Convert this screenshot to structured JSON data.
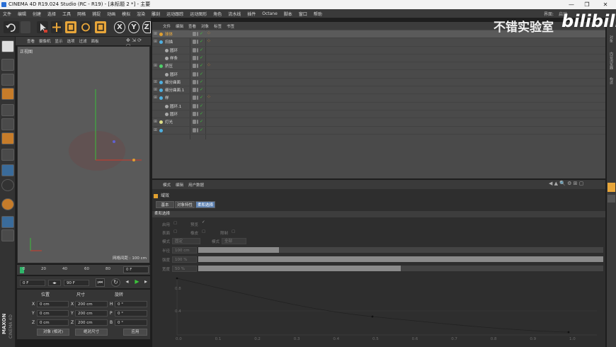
{
  "window": {
    "title": "CINEMA 4D R19.024 Studio (RC - R19) - [未标题 2 *] - 主要",
    "controls": [
      "—",
      "❐",
      "✕"
    ]
  },
  "menubar": {
    "items": [
      "文件",
      "编辑",
      "创建",
      "选择",
      "工具",
      "网格",
      "捕捉",
      "动画",
      "模拟",
      "渲染",
      "雕刻",
      "运动跟踪",
      "运动图形",
      "角色",
      "流水线",
      "插件",
      "Octane",
      "脚本",
      "窗口",
      "帮助"
    ],
    "layout_label": "界面:",
    "layout_value": "启动"
  },
  "toolbar": {
    "axis_x": "X",
    "axis_y": "Y",
    "axis_z": "Z"
  },
  "viewport": {
    "menu": [
      "查看",
      "摄像机",
      "显示",
      "选项",
      "过滤",
      "面板"
    ],
    "title": "正视图",
    "grid_spacing": "网格间距 : 100 cm"
  },
  "timeline": {
    "ticks": [
      "0",
      "20",
      "40",
      "60",
      "80"
    ],
    "current_frame": "0 F"
  },
  "transport": {
    "start_field": "0 F",
    "end_field": "90 F"
  },
  "coords": {
    "headers": [
      "位置",
      "尺寸",
      "旋转"
    ],
    "rows": [
      {
        "axis": "X",
        "pos": "0 cm",
        "size": "200 cm",
        "rot_label": "H",
        "rot": "0 °"
      },
      {
        "axis": "Y",
        "pos": "0 cm",
        "size": "200 cm",
        "rot_label": "P",
        "rot": "0 °"
      },
      {
        "axis": "Z",
        "pos": "0 cm",
        "size": "200 cm",
        "rot_label": "B",
        "rot": "0 °"
      }
    ],
    "mode_button": "对象 (相对)",
    "size_button": "绝对尺寸",
    "apply_button": "应用"
  },
  "object_manager": {
    "menu": [
      "文件",
      "编辑",
      "查看",
      "对象",
      "标签",
      "书签"
    ],
    "rows": [
      {
        "name": "球体",
        "color": "#e0a030",
        "highlight": true,
        "indent": 0,
        "dots": true
      },
      {
        "name": "扫描",
        "color": "#4fb0e0",
        "highlight": false,
        "indent": 0,
        "dots": true
      },
      {
        "name": "圆环",
        "color": "#aaaaaa",
        "highlight": false,
        "indent": 1,
        "dots": false
      },
      {
        "name": "样条",
        "color": "#aaaaaa",
        "highlight": false,
        "indent": 1,
        "dots": false
      },
      {
        "name": "挤压",
        "color": "#4fd06a",
        "highlight": false,
        "indent": 0,
        "dots": true
      },
      {
        "name": "圆环",
        "color": "#aaaaaa",
        "highlight": false,
        "indent": 1,
        "dots": false
      },
      {
        "name": "细分曲面",
        "color": "#4fb0e0",
        "highlight": false,
        "indent": 0,
        "dots": false
      },
      {
        "name": "细分曲面.1",
        "color": "#4fb0e0",
        "highlight": false,
        "indent": 0,
        "dots": false
      },
      {
        "name": "样",
        "color": "#4fb0e0",
        "highlight": false,
        "indent": 0,
        "dots": true
      },
      {
        "name": "圆环.1",
        "color": "#aaaaaa",
        "highlight": false,
        "indent": 1,
        "dots": false
      },
      {
        "name": "圆环",
        "color": "#aaaaaa",
        "highlight": false,
        "indent": 1,
        "dots": false
      },
      {
        "name": "灯光",
        "color": "#dddd88",
        "highlight": false,
        "indent": 0,
        "dots": false
      },
      {
        "name": "",
        "color": "#4fb0e0",
        "highlight": false,
        "indent": 0,
        "dots": false
      }
    ]
  },
  "attribute_manager": {
    "menu": [
      "模式",
      "编辑",
      "用户数据"
    ],
    "title": "域效",
    "tabs": [
      "基本",
      "对象特性",
      "柔和选择"
    ],
    "active_tab": 2,
    "section": "柔和选择",
    "params": {
      "enable": "启用",
      "preview": "预览",
      "surface": "表面",
      "rubber": "橡皮",
      "restrict": "限制",
      "mode_label": "模式",
      "mode_value": "固定",
      "mode2_label": "模式",
      "mode2_value": "全部",
      "radius_label": "半径",
      "radius_value": "100 cm",
      "strength_label": "强度",
      "strength_value": "100 %",
      "width_label": "宽度",
      "width_value": "50 %"
    },
    "sliders": {
      "radius": 0.2,
      "strength": 1.0,
      "width": 0.5
    },
    "graph": {
      "x_ticks": [
        "0.0",
        "0.1",
        "0.2",
        "0.3",
        "0.4",
        "0.5",
        "0.6",
        "0.7",
        "0.8",
        "0.9",
        "1.0"
      ],
      "y_ticks": [
        "0.8",
        "0.4"
      ]
    }
  },
  "right_strip": [
    "对象",
    "内容浏览器",
    "构造"
  ],
  "watermark": {
    "text": "不错实验室",
    "logo": "bilibili"
  }
}
